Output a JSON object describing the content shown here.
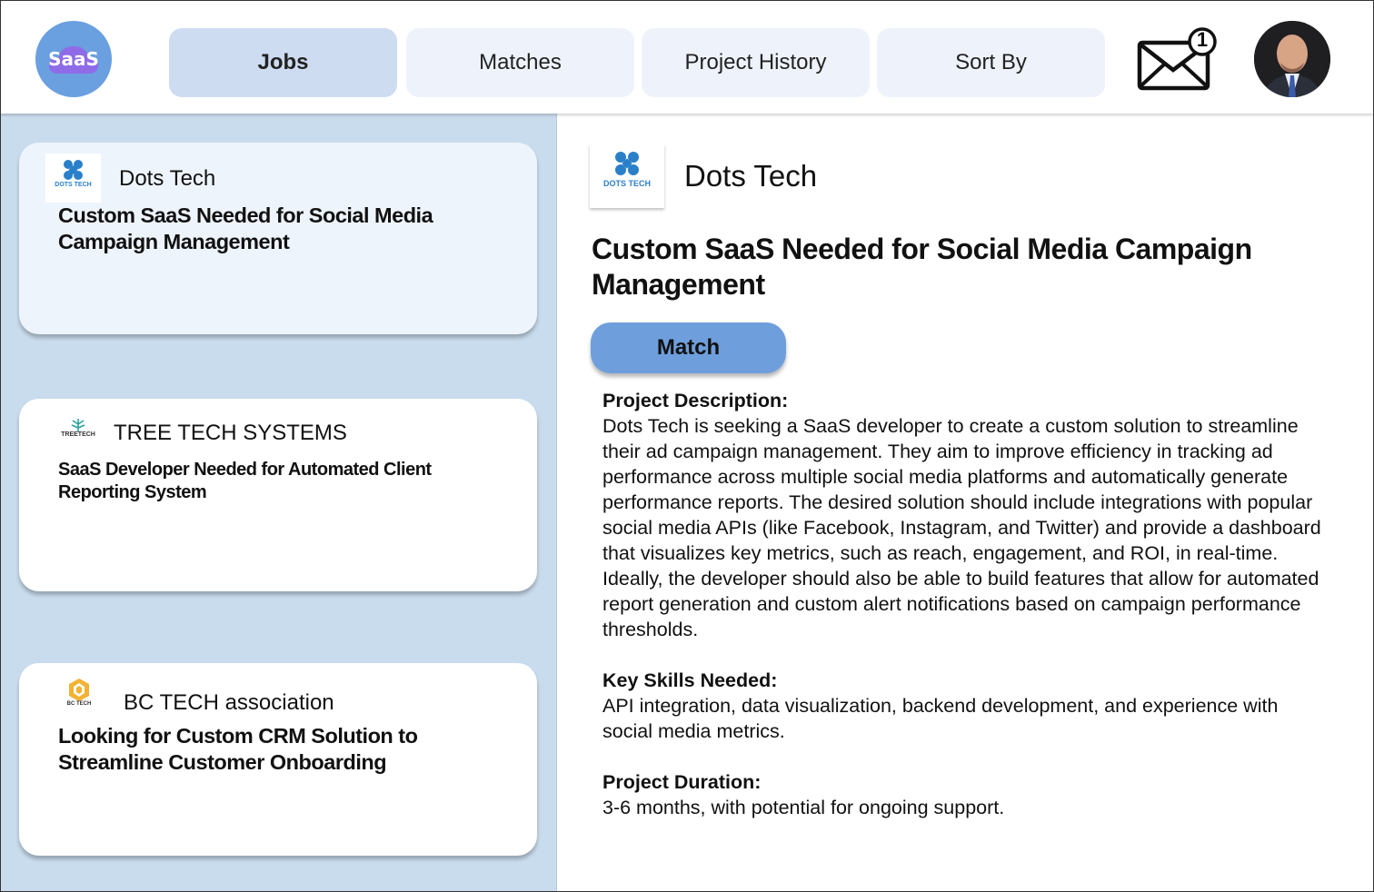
{
  "brand": {
    "logo_text": "SaaS",
    "accent": "#6a9fe0"
  },
  "nav": {
    "tabs": [
      {
        "label": "Jobs",
        "active": true
      },
      {
        "label": "Matches",
        "active": false
      },
      {
        "label": "Project History",
        "active": false
      },
      {
        "label": "Sort By",
        "active": false
      }
    ]
  },
  "header": {
    "notification_count": "1",
    "mail_icon": "envelope-icon",
    "avatar_icon": "user-avatar"
  },
  "jobs": [
    {
      "company": "Dots Tech",
      "logo_text": "DOTS TECH",
      "title": "Custom SaaS Needed for Social Media Campaign Management"
    },
    {
      "company": "TREE TECH SYSTEMS",
      "logo_text": "TREETECH",
      "title": "SaaS Developer Needed for Automated Client Reporting System"
    },
    {
      "company": "BC TECH association",
      "logo_text": "BC TECH",
      "title": "Looking for Custom CRM Solution to Streamline Customer Onboarding"
    }
  ],
  "detail": {
    "company": "Dots Tech",
    "logo_text": "DOTS TECH",
    "title": "Custom SaaS Needed for Social Media Campaign Management",
    "match_label": "Match",
    "description_heading": "Project Description:",
    "description": "Dots Tech is seeking a SaaS developer to create a custom solution to streamline their ad campaign management. They aim to improve efficiency in tracking ad performance across multiple social media platforms and automatically generate performance reports. The desired solution should include integrations with popular social media APIs (like Facebook, Instagram, and Twitter) and provide a dashboard that visualizes key metrics, such as reach, engagement, and ROI, in real-time. Ideally, the developer should also be able to build features that allow for automated report generation and custom alert notifications based on campaign performance thresholds.",
    "skills_heading": "Key Skills Needed:",
    "skills": "API integration, data visualization, backend development, and experience with social media metrics.",
    "duration_heading": "Project Duration:",
    "duration": "3-6 months, with potential for ongoing support."
  }
}
